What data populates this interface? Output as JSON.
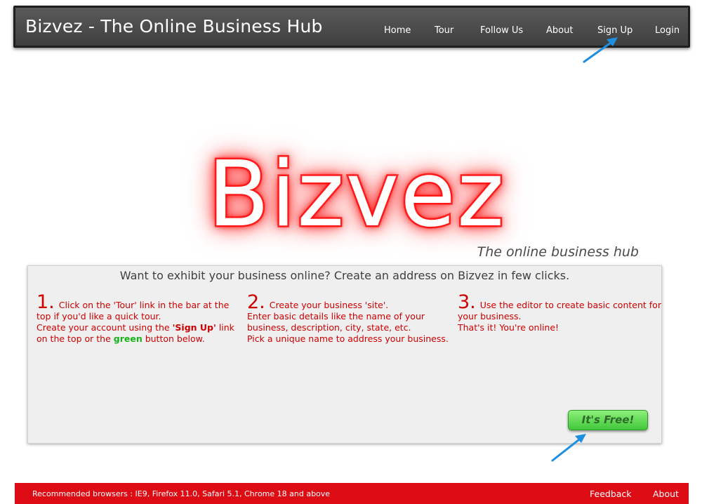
{
  "header": {
    "title": "Bizvez - The Online Business Hub",
    "nav": {
      "home": "Home",
      "tour": "Tour",
      "follow_us": "Follow Us",
      "about": "About",
      "sign_up": "Sign Up",
      "login": "Login"
    }
  },
  "hero": {
    "logo_text": "Bizvez",
    "tagline": "The online business hub"
  },
  "panel": {
    "heading": "Want to exhibit your business online? Create an address on Bizvez in few clicks.",
    "steps": [
      {
        "number": "1.",
        "line1": "Click on the 'Tour' link in the bar at the top if you'd like a quick tour.",
        "line2_pre": "Create your account using the ",
        "line2_bold": "'Sign Up'",
        "line2_mid": " link on the top or the ",
        "line2_green": "green",
        "line2_post": " button below."
      },
      {
        "number": "2.",
        "line1": "Create your business 'site'.",
        "line2": "Enter basic details like the name of your business, description, city, state, etc.",
        "line3": "Pick a unique name to address your business."
      },
      {
        "number": "3.",
        "line1": "Use the editor to create basic content for your business.",
        "line2": "That's it! You're online!"
      }
    ],
    "cta_label": "It's Free!"
  },
  "footer": {
    "browsers": "Recommended browsers : IE9, Firefox 11.0, Safari 5.1, Chrome 18 and above",
    "feedback": "Feedback",
    "about": "About"
  },
  "colors": {
    "topbar": "#4a4a4a",
    "accent_red": "#cc0000",
    "footer_red": "#dd0b14",
    "cta_green": "#40c83a",
    "arrow_blue": "#1e8fe0"
  },
  "icons": [
    "arrow-pointer-icon"
  ]
}
